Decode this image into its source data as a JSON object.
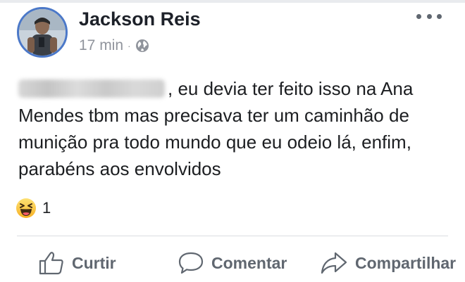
{
  "post": {
    "author": "Jackson Reis",
    "time": "17 min",
    "separator": "·",
    "privacy_icon": "globe-icon",
    "more_icon": "more-options-icon",
    "text_after_blur": ", eu devia ter feito isso na Ana Mendes tbm mas precisava ter um caminhão de munição pra todo mundo que eu odeio lá, enfim, parabéns aos envolvidos"
  },
  "reactions": {
    "icon": "haha-emoji-icon",
    "count": "1"
  },
  "actions": {
    "like_label": "Curtir",
    "comment_label": "Comentar",
    "share_label": "Compartilhar"
  },
  "colors": {
    "avatar_ring": "#4b78c8",
    "secondary_text": "#90949c",
    "action_text": "#606770"
  }
}
